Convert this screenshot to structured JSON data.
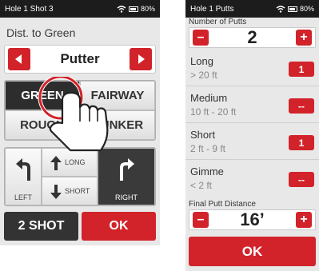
{
  "screenA": {
    "status": {
      "title": "Hole 1 Shot 3",
      "battery": "80%"
    },
    "distance_label": "Dist. to Green",
    "club": {
      "name": "Putter"
    },
    "lie_options": [
      {
        "label": "GREEN"
      },
      {
        "label": "FAIRWAY"
      },
      {
        "label": "ROUGH"
      },
      {
        "label": "BUNKER"
      }
    ],
    "direction": {
      "left_label": "LEFT",
      "long_label": "LONG",
      "short_label": "SHORT",
      "right_label": "RIGHT"
    },
    "buttons": {
      "two_shot": "2 SHOT",
      "ok": "OK"
    }
  },
  "screenB": {
    "status": {
      "title": "Hole 1 Putts",
      "battery": "80%"
    },
    "number_of_putts": {
      "label": "Number of Putts",
      "value": "2",
      "minus": "–",
      "plus": "+"
    },
    "ranges": [
      {
        "name": "Long",
        "range": "> 20 ft",
        "value": "1"
      },
      {
        "name": "Medium",
        "range": "10 ft - 20 ft",
        "value": "--"
      },
      {
        "name": "Short",
        "range": "2 ft - 9 ft",
        "value": "1"
      },
      {
        "name": "Gimme",
        "range": "< 2 ft",
        "value": "--"
      }
    ],
    "final_putt_distance": {
      "label": "Final Putt Distance",
      "value": "16’",
      "minus": "–",
      "plus": "+"
    },
    "ok": "OK"
  },
  "colors": {
    "accent": "#d2232a",
    "dark": "#2d2d2d",
    "panel": "#e8e8e8"
  }
}
